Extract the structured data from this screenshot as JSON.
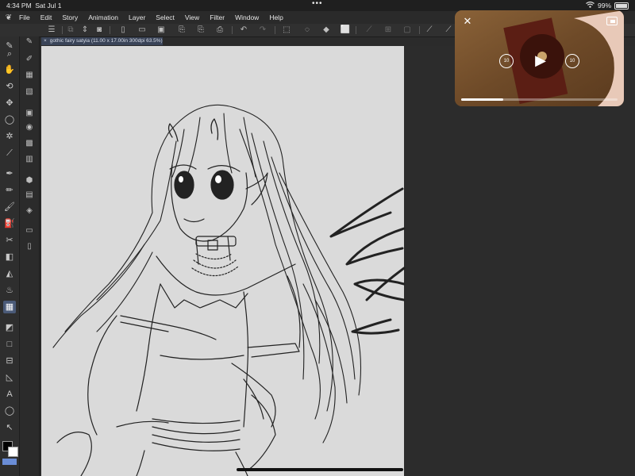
{
  "status": {
    "time": "4:34 PM",
    "date": "Sat Jul 1",
    "battery": "99%",
    "battery_level": 0.99,
    "dots": "•••"
  },
  "menu": {
    "app_icon": "clip-studio-icon",
    "items": [
      "File",
      "Edit",
      "Story",
      "Animation",
      "Layer",
      "Select",
      "View",
      "Filter",
      "Window",
      "Help"
    ]
  },
  "command_bar": {
    "icons": [
      "menu-icon",
      "copy-icon",
      "layer-icon",
      "reorder-icon",
      "capture-icon",
      "new-icon",
      "open-icon",
      "save-icon",
      "export-icon",
      "export-all-icon",
      "export-layer-icon",
      "share-icon",
      "undo-icon",
      "redo-icon",
      "select-all-icon",
      "deselect-icon",
      "fill-icon",
      "transform-icon",
      "crop-icon",
      "grid-icon",
      "ruler-icon",
      "snap-icon",
      "snap-special-icon"
    ]
  },
  "tools": [
    "pen-tab-icon",
    "zoom-icon",
    "hand-icon",
    "rotate-icon",
    "move-icon",
    "lasso-icon",
    "auto-select-icon",
    "eyedropper-icon",
    "pen-icon",
    "pencil-icon",
    "brush-icon",
    "airbrush-icon",
    "decoration-icon",
    "eraser-icon",
    "fill-icon",
    "blend-icon",
    "gradient-icon",
    "figure-icon",
    "frame-icon",
    "ruler-icon",
    "text-icon",
    "balloon-icon",
    "correct-line-icon"
  ],
  "active_tool": "ruler-icon",
  "document": {
    "tab_title": "gothic fairy satyia (11.00 x 17.00in 300dpi 63.5%)",
    "close_glyph": "×"
  },
  "pip": {
    "close_glyph": "✕",
    "rewind_label": "10",
    "forward_label": "10",
    "play_glyph": "▶",
    "progress": 0.27
  }
}
